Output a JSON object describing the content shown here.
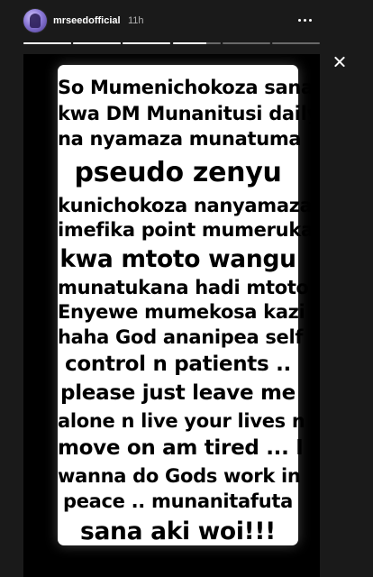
{
  "header": {
    "username": "mrseedofficial",
    "time_ago": "11h",
    "more_icon": "more-horizontal-icon",
    "close_icon": "close-icon"
  },
  "progress": {
    "segments": [
      {
        "fill": 1
      },
      {
        "fill": 1
      },
      {
        "fill": 1
      },
      {
        "fill": 0.7
      },
      {
        "fill": 0
      },
      {
        "fill": 0
      }
    ]
  },
  "story": {
    "lines": [
      "So Mumenichokoza sana",
      "kwa DM Munanitusi daily",
      "na nyamaza munatuma",
      "pseudo zenyu",
      "kunichokoza nanyamaza",
      "imefika point mumeruka",
      "kwa mtoto wangu",
      "munatukana hadi mtoto ?",
      "Enyewe mumekosa kazi",
      "haha God ananipea self",
      "control  n patients ..",
      "please just leave me",
      "alone n live your lives n",
      "move on am tired ... I",
      "wanna do Gods work in",
      "peace .. munanitafuta",
      "sana aki woi!!!"
    ]
  },
  "colors": {
    "background": "#1a1a1a",
    "media": "#000000",
    "card": "#ffffff",
    "text": "#000000"
  }
}
